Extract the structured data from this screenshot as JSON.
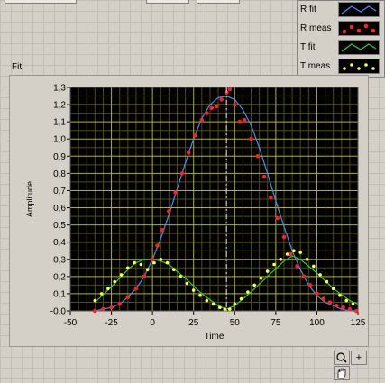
{
  "graph": {
    "title": "Fit",
    "xlabel": "Time",
    "ylabel": "Amplitude"
  },
  "legend": [
    {
      "label": "R fit",
      "icon": "blue-line-icon",
      "color": "#4a8cff"
    },
    {
      "label": "R meas",
      "icon": "red-dots-icon",
      "color": "#ff2020"
    },
    {
      "label": "T fit",
      "icon": "green-line-icon",
      "color": "#2fd02f"
    },
    {
      "label": "T meas",
      "icon": "yellow-dots-icon",
      "color": "#ffff40"
    }
  ],
  "toolbar": {
    "zoom_icon": "zoom-icon",
    "cursor_glyph": "+",
    "pan_icon": "hand-icon"
  },
  "chart_data": {
    "type": "scatter",
    "xlabel": "Time",
    "ylabel": "Amplitude",
    "xlim": [
      -50,
      125
    ],
    "ylim": [
      0,
      1.3
    ],
    "x_ticks": [
      "-50",
      "-25",
      "0",
      "25",
      "50",
      "75",
      "100",
      "125"
    ],
    "y_ticks": [
      "-0,0",
      "0,1",
      "0,2",
      "0,3",
      "0,4",
      "0,5",
      "0,6",
      "0,7",
      "0,8",
      "0,9",
      "1,0",
      "1,1",
      "1,2",
      "1,3"
    ],
    "grid": true,
    "cursor_x": 45,
    "series": [
      {
        "name": "R fit",
        "kind": "line",
        "color": "#4a8cff",
        "x": [
          -35,
          -30,
          -25,
          -20,
          -15,
          -10,
          -5,
          0,
          5,
          10,
          15,
          20,
          25,
          30,
          35,
          40,
          45,
          50,
          55,
          60,
          65,
          70,
          75,
          80,
          85,
          90,
          95,
          100,
          105,
          110,
          115,
          120,
          125
        ],
        "y": [
          0.0,
          0.01,
          0.02,
          0.04,
          0.08,
          0.13,
          0.2,
          0.3,
          0.42,
          0.56,
          0.71,
          0.86,
          1.0,
          1.12,
          1.2,
          1.24,
          1.25,
          1.23,
          1.17,
          1.08,
          0.95,
          0.8,
          0.64,
          0.49,
          0.35,
          0.24,
          0.15,
          0.09,
          0.05,
          0.03,
          0.01,
          0.0,
          0.0
        ]
      },
      {
        "name": "R meas",
        "kind": "markers",
        "color": "#ff2020",
        "x": [
          -35,
          -30,
          -25,
          -20,
          -15,
          -10,
          -5,
          0,
          3,
          6,
          10,
          14,
          18,
          22,
          26,
          30,
          33,
          36,
          39,
          42,
          45,
          47,
          50,
          53,
          56,
          60,
          64,
          68,
          72,
          76,
          80,
          84,
          88,
          92,
          96,
          100,
          104,
          108,
          112,
          116,
          120,
          124
        ],
        "y": [
          0.0,
          0.01,
          0.02,
          0.04,
          0.08,
          0.13,
          0.2,
          0.3,
          0.38,
          0.47,
          0.58,
          0.69,
          0.8,
          0.92,
          1.02,
          1.11,
          1.15,
          1.18,
          1.19,
          1.23,
          1.27,
          1.29,
          1.2,
          1.1,
          1.11,
          1.0,
          0.9,
          0.78,
          0.66,
          0.54,
          0.43,
          0.33,
          0.26,
          0.2,
          0.15,
          0.1,
          0.07,
          0.05,
          0.03,
          0.02,
          0.01,
          0.0
        ]
      },
      {
        "name": "T fit",
        "kind": "line",
        "color": "#2fd02f",
        "x": [
          -35,
          -25,
          -15,
          -10,
          -5,
          0,
          5,
          10,
          20,
          30,
          40,
          45,
          50,
          60,
          70,
          80,
          85,
          90,
          100,
          110,
          120,
          125
        ],
        "y": [
          0.05,
          0.14,
          0.24,
          0.28,
          0.3,
          0.3,
          0.29,
          0.27,
          0.19,
          0.1,
          0.03,
          0.01,
          0.03,
          0.11,
          0.2,
          0.29,
          0.32,
          0.3,
          0.22,
          0.13,
          0.06,
          0.04
        ]
      },
      {
        "name": "T meas",
        "kind": "markers",
        "color": "#ffff40",
        "x": [
          -35,
          -31,
          -27,
          -23,
          -19,
          -15,
          -11,
          -7,
          -3,
          1,
          5,
          9,
          13,
          17,
          21,
          25,
          29,
          33,
          37,
          41,
          44,
          47,
          50,
          54,
          58,
          62,
          66,
          70,
          74,
          78,
          82,
          86,
          90,
          94,
          98,
          102,
          106,
          110,
          114,
          118,
          122
        ],
        "y": [
          0.06,
          0.1,
          0.13,
          0.17,
          0.21,
          0.25,
          0.28,
          0.27,
          0.24,
          0.28,
          0.3,
          0.28,
          0.24,
          0.2,
          0.16,
          0.12,
          0.09,
          0.06,
          0.04,
          0.02,
          0.01,
          0.01,
          0.04,
          0.07,
          0.11,
          0.15,
          0.19,
          0.23,
          0.27,
          0.3,
          0.33,
          0.35,
          0.34,
          0.3,
          0.26,
          0.21,
          0.17,
          0.13,
          0.09,
          0.06,
          0.04
        ]
      }
    ]
  }
}
